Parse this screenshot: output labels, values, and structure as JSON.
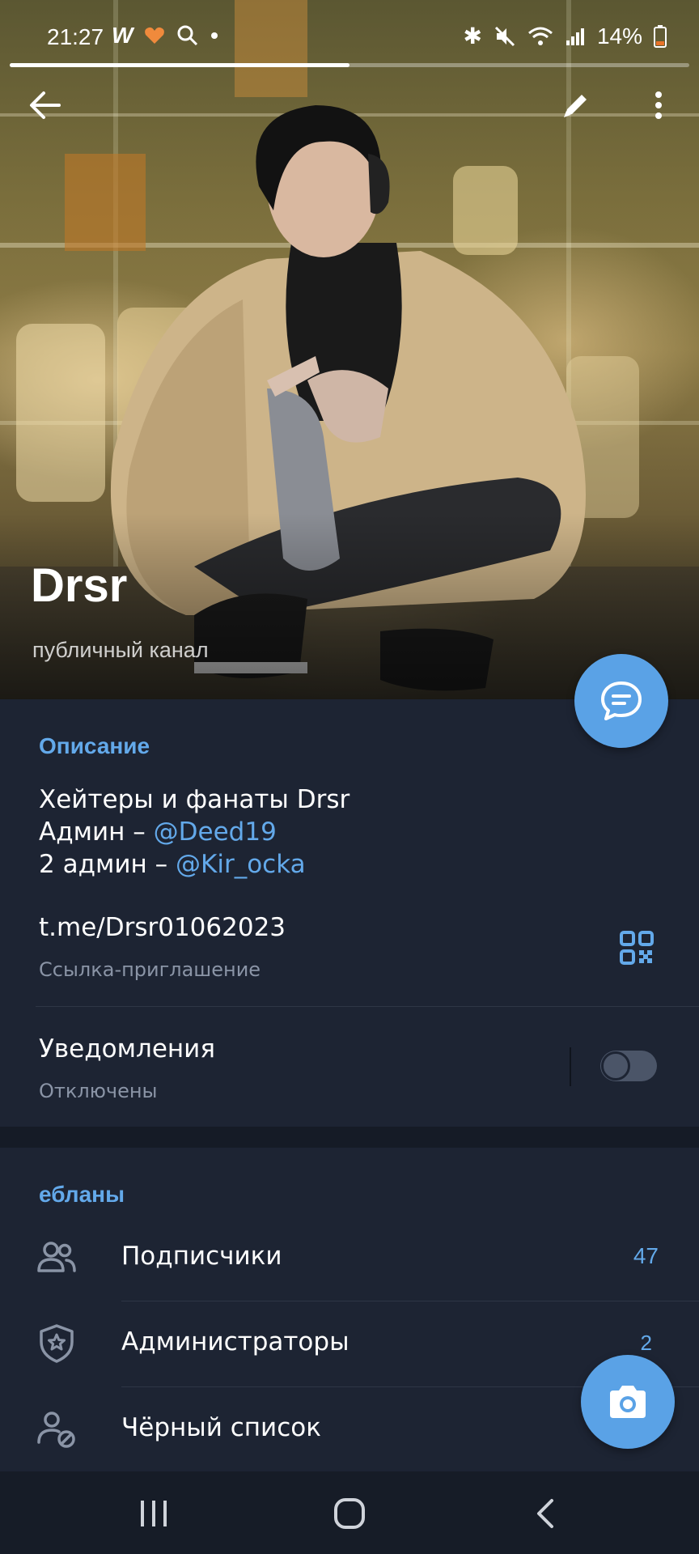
{
  "status_bar": {
    "time": "21:27",
    "battery": "14%",
    "icons": [
      "w-app-icon",
      "heart-icon",
      "search-icon",
      "dot-icon",
      "bluetooth-icon",
      "mute-icon",
      "wifi-icon",
      "signal-icon",
      "battery-icon"
    ]
  },
  "header": {
    "channel_name": "Drsr",
    "channel_type": "публичный канал",
    "story_progress": 0.5,
    "buttons": [
      "back-arrow-icon",
      "edit-pencil-icon",
      "more-vertical-icon"
    ]
  },
  "info": {
    "description_title": "Описание",
    "description": {
      "line1": "Хейтеры и фанаты Drsr",
      "line2_prefix": "Админ – ",
      "line2_mention": "@Deed19",
      "line3_prefix": "2 админ – ",
      "line3_mention": "@Kir_ocka"
    },
    "invite_link": "t.me/Drsr01062023",
    "invite_link_caption": "Ссылка-приглашение",
    "notifications_label": "Уведомления",
    "notifications_status": "Отключены",
    "notifications_enabled": false
  },
  "members": {
    "section_title": "ебланы",
    "items": [
      {
        "label": "Подписчики",
        "count": "47",
        "icon": "people-icon"
      },
      {
        "label": "Администраторы",
        "count": "2",
        "icon": "shield-star-icon"
      },
      {
        "label": "Чёрный список",
        "count": "",
        "icon": "user-blocked-icon"
      }
    ]
  },
  "colors": {
    "accent": "#63a9ea",
    "fab": "#5aa2e6",
    "background": "#1d2433",
    "navbar": "#161c27"
  }
}
